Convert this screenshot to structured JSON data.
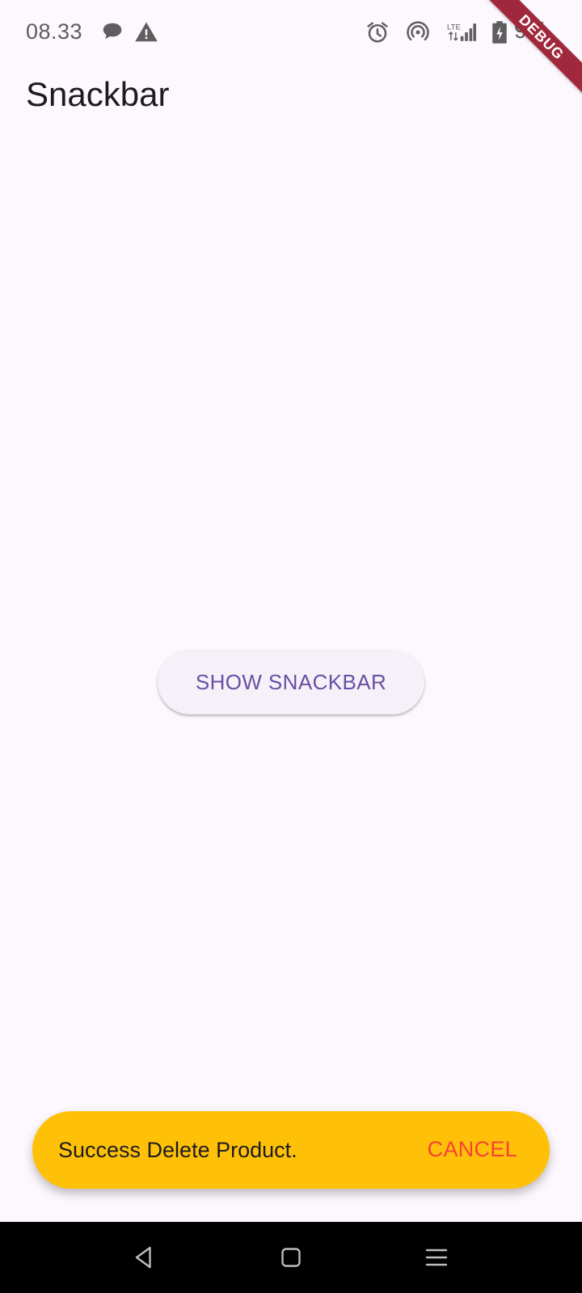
{
  "status_bar": {
    "time": "08.33",
    "battery_text": "9%",
    "icons": [
      "chat-bubble-icon",
      "warning-icon",
      "alarm-icon",
      "hotspot-icon",
      "lte-signal-icon",
      "battery-charging-icon"
    ]
  },
  "debug_banner": {
    "label": "DEBUG"
  },
  "app_bar": {
    "title": "Snackbar"
  },
  "main": {
    "show_button_label": "SHOW SNACKBAR"
  },
  "snackbar": {
    "message": "Success Delete Product.",
    "action_label": "CANCEL",
    "background_color": "#FFC107",
    "action_color": "#F44336"
  },
  "nav_bar": {
    "buttons": [
      "back-icon",
      "home-icon",
      "recents-icon"
    ]
  },
  "colors": {
    "background": "#FDF7FE",
    "primary": "#6750A4",
    "debug_banner": "#A0283C"
  }
}
